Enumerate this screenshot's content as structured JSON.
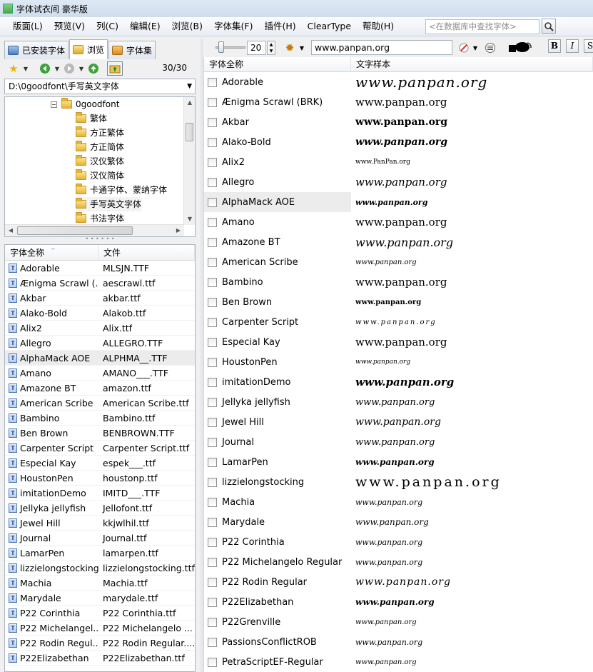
{
  "window": {
    "title": "字体试衣间 豪华版"
  },
  "menu": [
    {
      "label": "版面(L)"
    },
    {
      "label": "预览(V)"
    },
    {
      "label": "列(C)"
    },
    {
      "label": "编辑(E)"
    },
    {
      "label": "浏览(B)"
    },
    {
      "label": "字体集(F)"
    },
    {
      "label": "插件(H)"
    },
    {
      "label": "ClearType"
    },
    {
      "label": "帮助(H)"
    }
  ],
  "search": {
    "placeholder": "<在数据库中查找字体>"
  },
  "left_tabs": [
    {
      "label": "已安装字体",
      "icon": "monitor-icon"
    },
    {
      "label": "浏览",
      "icon": "folder-icon",
      "active": true
    },
    {
      "label": "字体集",
      "icon": "box-icon"
    }
  ],
  "left_toolbar": {
    "count": "30/30"
  },
  "path": {
    "value": "D:\\0goodfont\\手写英文字体"
  },
  "tree": {
    "root": "0goodfont",
    "children": [
      {
        "label": "繁体"
      },
      {
        "label": "方正繁体"
      },
      {
        "label": "方正简体"
      },
      {
        "label": "汉仪繁体"
      },
      {
        "label": "汉仪简体"
      },
      {
        "label": "卡通字体、蒙纳字体"
      },
      {
        "label": "手写英文字体"
      },
      {
        "label": "书法字体"
      }
    ]
  },
  "file_list": {
    "headers": [
      "字体全称",
      "文件"
    ],
    "rows": [
      {
        "name": "Adorable",
        "file": "MLSJN.TTF"
      },
      {
        "name": "Ænigma Scrawl (...",
        "file": "aescrawl.ttf"
      },
      {
        "name": "Akbar",
        "file": "akbar.ttf"
      },
      {
        "name": "Alako-Bold",
        "file": "Alakob.ttf"
      },
      {
        "name": "Alix2",
        "file": "Alix.ttf"
      },
      {
        "name": "Allegro",
        "file": "ALLEGRO.TTF"
      },
      {
        "name": "AlphaMack AOE",
        "file": "ALPHMA__.TTF"
      },
      {
        "name": "Amano",
        "file": "AMANO___.TTF"
      },
      {
        "name": "Amazone BT",
        "file": "amazon.ttf"
      },
      {
        "name": "American Scribe",
        "file": "American Scribe.ttf"
      },
      {
        "name": "Bambino",
        "file": "Bambino.ttf"
      },
      {
        "name": "Ben Brown",
        "file": "BENBROWN.TTF"
      },
      {
        "name": "Carpenter Script",
        "file": "Carpenter Script.ttf"
      },
      {
        "name": "Especial Kay",
        "file": "espek___.ttf"
      },
      {
        "name": "HoustonPen",
        "file": "houstonp.ttf"
      },
      {
        "name": "imitationDemo",
        "file": "IMITD___.TTF"
      },
      {
        "name": "Jellyka jellyfish",
        "file": "Jellofont.ttf"
      },
      {
        "name": "Jewel Hill",
        "file": "kkjwlhil.ttf"
      },
      {
        "name": "Journal",
        "file": "Journal.ttf"
      },
      {
        "name": "LamarPen",
        "file": "lamarpen.ttf"
      },
      {
        "name": "lizzielongstocking",
        "file": "lizzielongstocking.ttf"
      },
      {
        "name": "Machia",
        "file": "Machia.ttf"
      },
      {
        "name": "Marydale",
        "file": "marydale.ttf"
      },
      {
        "name": "P22 Corinthia",
        "file": "P22 Corinthia.ttf"
      },
      {
        "name": "P22 Michelangel...",
        "file": "P22 Michelangelo ..."
      },
      {
        "name": "P22 Rodin Regul...",
        "file": "P22 Rodin Regular...."
      },
      {
        "name": "P22Elizabethan",
        "file": "P22Elizabethan.ttf"
      }
    ]
  },
  "right_toolbar": {
    "font_size": "20",
    "sample_text": "www.panpan.org"
  },
  "sample_list": {
    "headers": [
      "字体全称",
      "文字样本"
    ],
    "rows": [
      {
        "name": "Adorable",
        "sample": "www.panpan.org"
      },
      {
        "name": "Ænigma Scrawl (BRK)",
        "sample": "www.panpan.org"
      },
      {
        "name": "Akbar",
        "sample": "www.panpan.org"
      },
      {
        "name": "Alako-Bold",
        "sample": "www.panpan.org"
      },
      {
        "name": "Alix2",
        "sample": "www.PanPan.org"
      },
      {
        "name": "Allegro",
        "sample": "www.panpan.org"
      },
      {
        "name": "AlphaMack AOE",
        "sample": "www.panpan.org"
      },
      {
        "name": "Amano",
        "sample": "www.panpan.org"
      },
      {
        "name": "Amazone BT",
        "sample": "www.panpan.org"
      },
      {
        "name": "American Scribe",
        "sample": "www.panpan.org"
      },
      {
        "name": "Bambino",
        "sample": "www.panpan.org"
      },
      {
        "name": "Ben Brown",
        "sample": "www.panpan.org"
      },
      {
        "name": "Carpenter Script",
        "sample": "www.panpan.org"
      },
      {
        "name": "Especial Kay",
        "sample": "www.panpan.org"
      },
      {
        "name": "HoustonPen",
        "sample": "www.panpan.org"
      },
      {
        "name": "imitationDemo",
        "sample": "www.panpan.org"
      },
      {
        "name": "Jellyka jellyfish",
        "sample": "www.panpan.org"
      },
      {
        "name": "Jewel Hill",
        "sample": "www.panpan.org"
      },
      {
        "name": "Journal",
        "sample": "www.panpan.org"
      },
      {
        "name": "LamarPen",
        "sample": "www.panpan.org"
      },
      {
        "name": "lizzielongstocking",
        "sample": "www.panpan.org"
      },
      {
        "name": "Machia",
        "sample": "www.panpan.org"
      },
      {
        "name": "Marydale",
        "sample": "www.panpan.org"
      },
      {
        "name": "P22 Corinthia",
        "sample": "www.panpan.org"
      },
      {
        "name": "P22 Michelangelo Regular",
        "sample": "www.panpan.org"
      },
      {
        "name": "P22 Rodin Regular",
        "sample": "www.panpan.org"
      },
      {
        "name": "P22Elizabethan",
        "sample": "www.panpan.org"
      },
      {
        "name": "P22Grenville",
        "sample": "www.panpan.org"
      },
      {
        "name": "PassionsConflictROB",
        "sample": "www.panpan.org"
      },
      {
        "name": "PetraScriptEF-Regular",
        "sample": "www.panpan.org"
      }
    ]
  },
  "selected_font": "AlphaMack AOE",
  "colors": {
    "selection": "#ececec",
    "menu_bg": "#eef2f7",
    "border": "#a8b3c1"
  }
}
